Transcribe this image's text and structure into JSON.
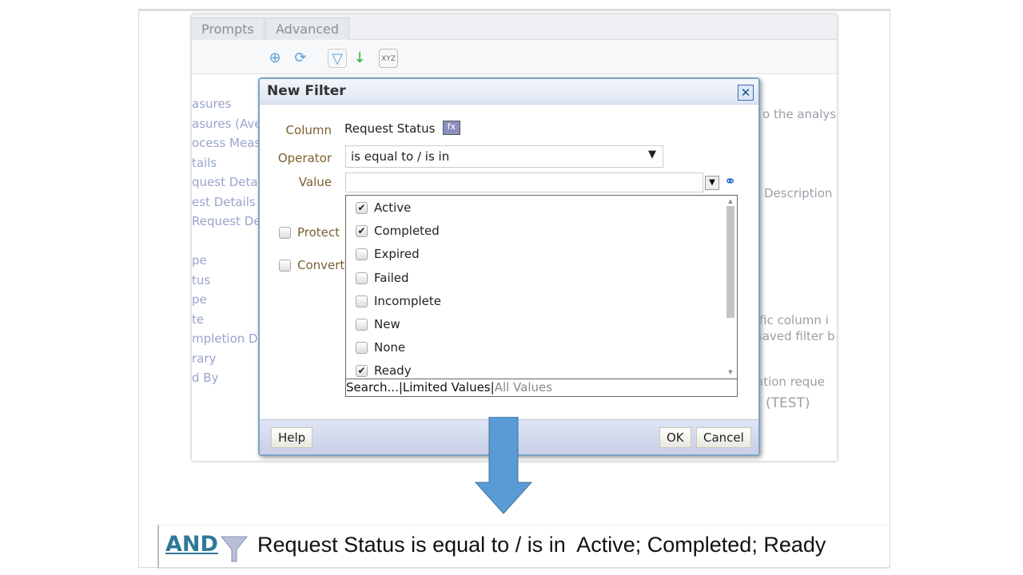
{
  "tabs": [
    "Prompts",
    "Advanced"
  ],
  "toolbar_icons": [
    "add-icon",
    "refresh-icon",
    "filter-icon",
    "sort-icon",
    "xyz-icon"
  ],
  "sidebar_items": [
    "asures",
    "asures (Ave",
    "ocess Measu",
    "tails",
    "quest Detai",
    "est Details",
    "Request De",
    "",
    "pe",
    "tus",
    "pe",
    "te",
    "mpletion Da",
    "rary",
    "d By"
  ],
  "background_text": {
    "analysis": "o the analysi",
    "description": "Description",
    "column": "ific column i",
    "saved": "saved filter b",
    "request": "ation reque",
    "test": "(TEST)"
  },
  "dialog": {
    "title": "New Filter",
    "column_label": "Column",
    "column_value": "Request Status",
    "operator_label": "Operator",
    "operator_value": "is equal to / is in",
    "value_label": "Value",
    "value_input": "",
    "protect_label": "Protect",
    "convert_label": "Convert",
    "values": [
      {
        "label": "Active",
        "checked": true
      },
      {
        "label": "Completed",
        "checked": true
      },
      {
        "label": "Expired",
        "checked": false
      },
      {
        "label": "Failed",
        "checked": false
      },
      {
        "label": "Incomplete",
        "checked": false
      },
      {
        "label": "New",
        "checked": false
      },
      {
        "label": "None",
        "checked": false
      },
      {
        "label": "Ready",
        "checked": true
      }
    ],
    "search_link": "Search...",
    "limited_link": "Limited Values",
    "all_link": "All Values",
    "help": "Help",
    "ok": "OK",
    "cancel": "Cancel"
  },
  "result": {
    "and": "AND",
    "text": "Request Status is equal to / is in  Active; Completed; Ready"
  },
  "colors": {
    "arrow": "#5b9bd5",
    "and_link": "#2e7a96",
    "label": "#7a6030"
  }
}
